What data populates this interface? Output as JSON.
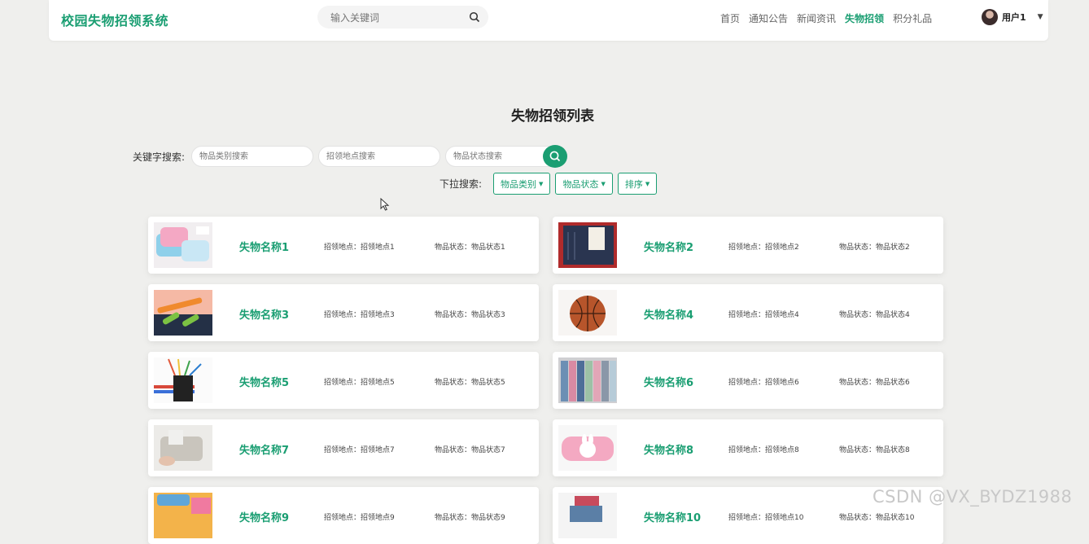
{
  "navbar": {
    "brand": "校园失物招领系统",
    "search_placeholder": "输入关键词",
    "menu": [
      "首页",
      "通知公告",
      "新闻资讯",
      "失物招领",
      "积分礼品"
    ],
    "active_index": 3,
    "user": "用户1"
  },
  "page": {
    "title": "失物招领列表"
  },
  "search": {
    "label": "关键字搜索:",
    "category_placeholder": "物品类别搜索",
    "location_placeholder": "招领地点搜索",
    "status_placeholder": "物品状态搜索"
  },
  "dropdowns": {
    "label": "下拉搜索:",
    "category": "物品类别",
    "status": "物品状态",
    "sort": "排序"
  },
  "items": [
    {
      "name": "失物名称1",
      "location": "招领地点：招领地点1",
      "status": "物品状态：物品状态1",
      "image": "pencil-case"
    },
    {
      "name": "失物名称2",
      "location": "招领地点：招领地点2",
      "status": "物品状态：物品状态2",
      "image": "book"
    },
    {
      "name": "失物名称3",
      "location": "招领地点：招领地点3",
      "status": "物品状态：物品状态3",
      "image": "highlighters"
    },
    {
      "name": "失物名称4",
      "location": "招领地点：招领地点4",
      "status": "物品状态：物品状态4",
      "image": "basketball"
    },
    {
      "name": "失物名称5",
      "location": "招领地点：招领地点5",
      "status": "物品状态：物品状态5",
      "image": "pen-holder"
    },
    {
      "name": "失物名称6",
      "location": "招领地点：招领地点6",
      "status": "物品状态：物品状态6",
      "image": "notebooks"
    },
    {
      "name": "失物名称7",
      "location": "招领地点：招领地点7",
      "status": "物品状态：物品状态7",
      "image": "bag"
    },
    {
      "name": "失物名称8",
      "location": "招领地点：招领地点8",
      "status": "物品状态：物品状态8",
      "image": "pink-case"
    },
    {
      "name": "失物名称9",
      "location": "招领地点：招领地点9",
      "status": "物品状态：物品状态9",
      "image": "stationery"
    },
    {
      "name": "失物名称10",
      "location": "招领地点：招领地点10",
      "status": "物品状态：物品状态10",
      "image": "box"
    }
  ],
  "watermark": "CSDN @VX_BYDZ1988",
  "colors": {
    "accent": "#1a9e72",
    "background": "#efefed"
  }
}
